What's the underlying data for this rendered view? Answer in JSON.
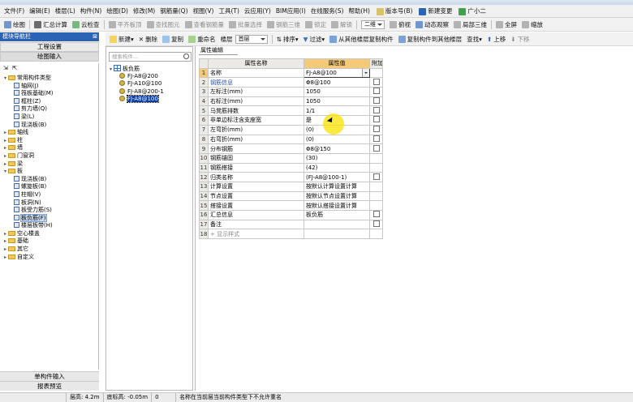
{
  "menu": [
    "文件(F)",
    "编辑(E)",
    "楼层(L)",
    "构件(N)",
    "绘图(D)",
    "修改(M)",
    "钢筋量(Q)",
    "视图(V)",
    "工具(T)",
    "云应用(Y)",
    "BIM应用(I)",
    "在线服务(S)",
    "帮助(H)",
    "版本号(B)",
    "新建变更",
    "广小二"
  ],
  "toolbar1": [
    "绘图",
    "汇总计算",
    "云检查",
    "平齐板顶",
    "查找图元",
    "查看钢筋量",
    "批量选择",
    "钢筋三维",
    "锁定",
    "解锁",
    "二维",
    "俯视",
    "动态观察",
    "局部三维",
    "全屏",
    "缩放"
  ],
  "toolbar2": {
    "new_label": "新建",
    "delete_label": "删除",
    "copy_label": "复制",
    "rename_label": "重命名",
    "floor_label": "楼层",
    "floor_value": "首层",
    "sort_label": "排序",
    "filter_label": "过滤",
    "copy_from_label": "从其他楼层复制构件",
    "copy_to_label": "复制构件到其他楼层",
    "find_label": "查找",
    "up_label": "上移",
    "down_label": "下移"
  },
  "nav": {
    "title": "模块导航栏",
    "project_settings": "工程设置",
    "drawing_input": "绘图输入",
    "single_input": "单构件输入",
    "report_preview": "报表预览",
    "tree": [
      {
        "label": "常用构件类型",
        "level": 0,
        "type": "folder",
        "open": true
      },
      {
        "label": "轴网(J)",
        "level": 1,
        "type": "leaf"
      },
      {
        "label": "筏板基础(M)",
        "level": 1,
        "type": "leaf"
      },
      {
        "label": "框柱(Z)",
        "level": 1,
        "type": "leaf"
      },
      {
        "label": "剪力墙(Q)",
        "level": 1,
        "type": "leaf"
      },
      {
        "label": "梁(L)",
        "level": 1,
        "type": "leaf"
      },
      {
        "label": "现浇板(B)",
        "level": 1,
        "type": "leaf"
      },
      {
        "label": "轴线",
        "level": 0,
        "type": "folder"
      },
      {
        "label": "柱",
        "level": 0,
        "type": "folder"
      },
      {
        "label": "墙",
        "level": 0,
        "type": "folder"
      },
      {
        "label": "门窗洞",
        "level": 0,
        "type": "folder"
      },
      {
        "label": "梁",
        "level": 0,
        "type": "folder"
      },
      {
        "label": "板",
        "level": 0,
        "type": "folder",
        "open": true
      },
      {
        "label": "现浇板(B)",
        "level": 1,
        "type": "leaf"
      },
      {
        "label": "螺旋板(B)",
        "level": 1,
        "type": "leaf"
      },
      {
        "label": "柱帽(V)",
        "level": 1,
        "type": "leaf"
      },
      {
        "label": "板洞(N)",
        "level": 1,
        "type": "leaf"
      },
      {
        "label": "板受力筋(S)",
        "level": 1,
        "type": "leaf"
      },
      {
        "label": "板负筋(F)",
        "level": 1,
        "type": "leaf",
        "selected": true
      },
      {
        "label": "楼层板带(H)",
        "level": 1,
        "type": "leaf"
      },
      {
        "label": "空心楼盖",
        "level": 0,
        "type": "folder"
      },
      {
        "label": "基础",
        "level": 0,
        "type": "folder"
      },
      {
        "label": "其它",
        "level": 0,
        "type": "folder"
      },
      {
        "label": "自定义",
        "level": 0,
        "type": "folder"
      }
    ]
  },
  "component_list": {
    "search_placeholder": "搜索构件...",
    "root": "板负筋",
    "items": [
      "FJ-A8@200",
      "FJ-A10@100",
      "FJ-A8@200-1",
      "FJ-A8@100"
    ],
    "selected_index": 3
  },
  "props": {
    "tab": "属性编辑",
    "headers": [
      "属性名称",
      "属性值",
      "附加"
    ],
    "rows": [
      {
        "num": "1",
        "name": "名称",
        "value": "FJ-A8@100",
        "check": false,
        "style": "",
        "editing": true
      },
      {
        "num": "2",
        "name": "钢筋信息",
        "value": "Φ8@100",
        "check": true,
        "style": "blue"
      },
      {
        "num": "3",
        "name": "左标注(mm)",
        "value": "1050",
        "check": true,
        "style": ""
      },
      {
        "num": "4",
        "name": "右标注(mm)",
        "value": "1050",
        "check": true,
        "style": ""
      },
      {
        "num": "5",
        "name": "马凳筋排数",
        "value": "1/1",
        "check": true,
        "style": ""
      },
      {
        "num": "6",
        "name": "非单边标注含支座宽",
        "value": "是",
        "check": true,
        "style": ""
      },
      {
        "num": "7",
        "name": "左弯折(mm)",
        "value": "(0)",
        "check": true,
        "style": ""
      },
      {
        "num": "8",
        "name": "右弯折(mm)",
        "value": "(0)",
        "check": true,
        "style": ""
      },
      {
        "num": "9",
        "name": "分布钢筋",
        "value": "Φ8@150",
        "check": true,
        "style": ""
      },
      {
        "num": "10",
        "name": "钢筋锚固",
        "value": "(30)",
        "check": false,
        "style": ""
      },
      {
        "num": "11",
        "name": "钢筋搭接",
        "value": "(42)",
        "check": false,
        "style": ""
      },
      {
        "num": "12",
        "name": "归类名称",
        "value": "(FJ-A8@100-1)",
        "check": true,
        "style": ""
      },
      {
        "num": "13",
        "name": "计算设置",
        "value": "按默认计算设置计算",
        "check": false,
        "style": ""
      },
      {
        "num": "14",
        "name": "节点设置",
        "value": "按默认节点设置计算",
        "check": false,
        "style": ""
      },
      {
        "num": "15",
        "name": "搭接设置",
        "value": "按默认搭接设置计算",
        "check": false,
        "style": ""
      },
      {
        "num": "16",
        "name": "汇总信息",
        "value": "板负筋",
        "check": true,
        "style": ""
      },
      {
        "num": "17",
        "name": "备注",
        "value": "",
        "check": true,
        "style": ""
      },
      {
        "num": "18",
        "name": "显示样式",
        "value": "",
        "check": false,
        "style": "gray",
        "expand": true
      }
    ]
  },
  "status": {
    "floor_height": "层高: 4.2m",
    "bottom_elev": "底标高: -0.05m",
    "count": "0",
    "message": "名称在当前层当前构件类型下不允许重名"
  }
}
